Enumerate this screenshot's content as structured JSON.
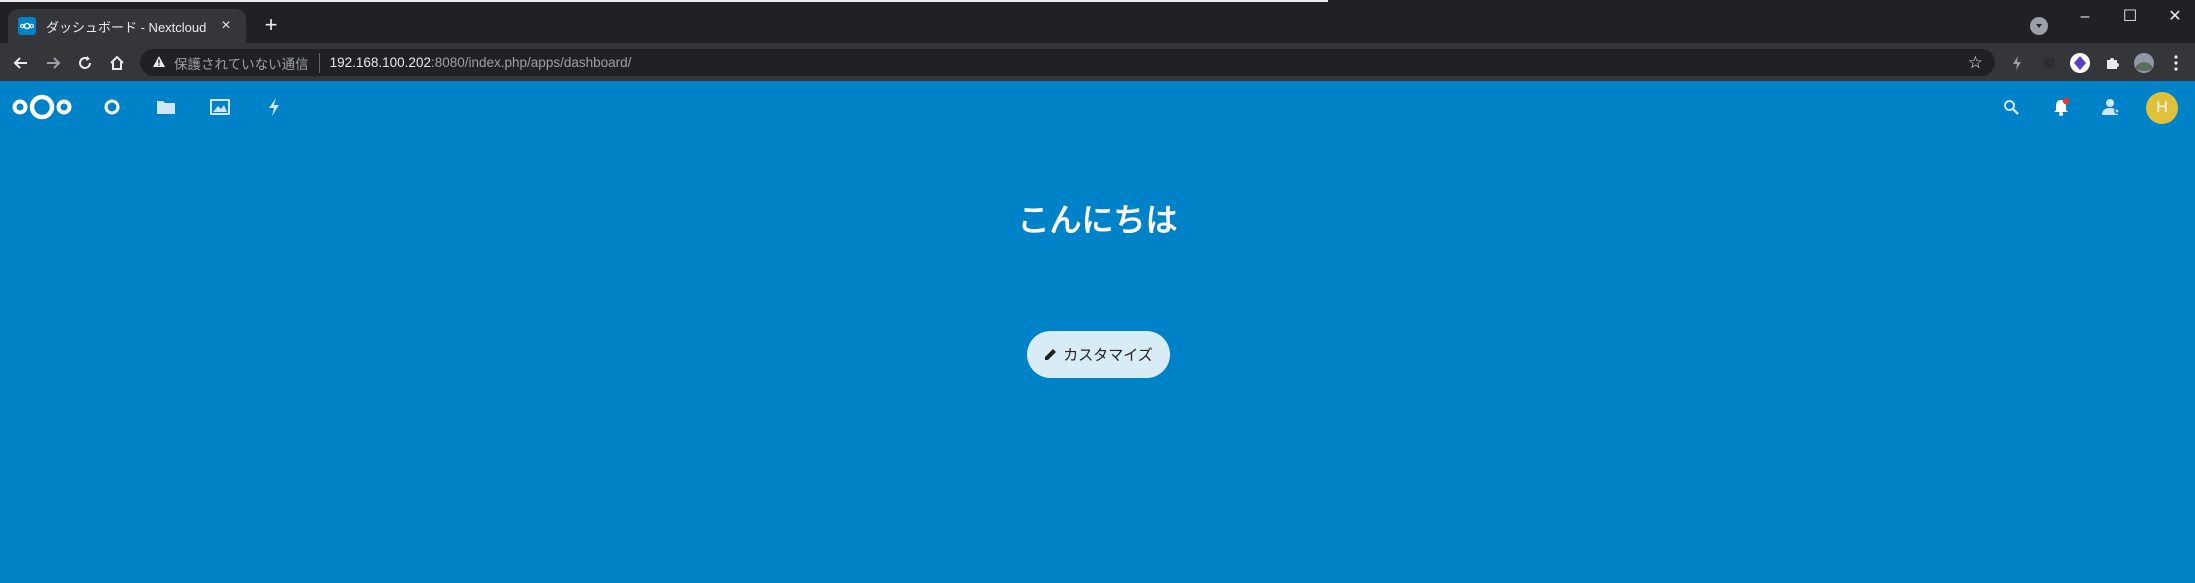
{
  "browser": {
    "tab": {
      "title": "ダッシュボード - Nextcloud",
      "close": "×"
    },
    "new_tab": "+",
    "window_controls": {
      "minimize": "–",
      "maximize": "☐",
      "close": "✕"
    },
    "address_bar": {
      "security_label": "保護されていない通信",
      "url_host": "192.168.100.202",
      "url_rest": ":8080/index.php/apps/dashboard/"
    }
  },
  "nextcloud": {
    "header_apps": [
      {
        "name": "dashboard",
        "icon": "circle-icon"
      },
      {
        "name": "files",
        "icon": "folder-icon"
      },
      {
        "name": "photos",
        "icon": "image-icon"
      },
      {
        "name": "activity",
        "icon": "lightning-icon"
      }
    ],
    "avatar_letter": "H",
    "greeting": "こんにちは",
    "customize_label": "カスタマイズ"
  },
  "colors": {
    "brand": "#0082c9",
    "avatar": "#e0c23a",
    "notification_dot": "#e9322d"
  }
}
